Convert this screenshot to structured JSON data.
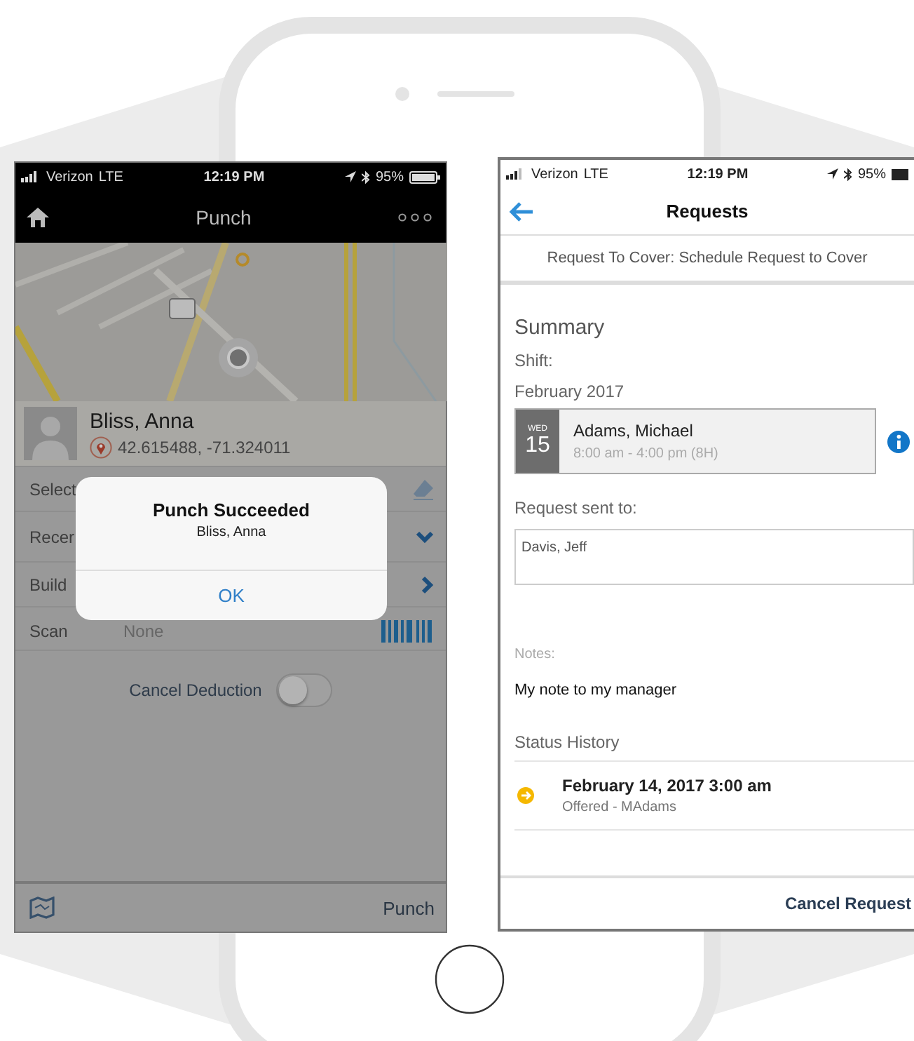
{
  "left_screen": {
    "status_bar": {
      "carrier": "Verizon",
      "network": "LTE",
      "time": "12:19 PM",
      "battery": "95%"
    },
    "nav_bar": {
      "title": "Punch"
    },
    "employee": {
      "name": "Bliss, Anna",
      "coordinates": "42.615488, -71.324011"
    },
    "rows": [
      {
        "kind": "edit",
        "label": "Select"
      },
      {
        "kind": "dropdown",
        "label": "Recer"
      },
      {
        "kind": "link",
        "label": "Build"
      },
      {
        "kind": "scan",
        "label": "Scan",
        "value": "None"
      }
    ],
    "cancel_deduction": {
      "label": "Cancel Deduction",
      "on": false
    },
    "footer": {
      "action": "Punch"
    },
    "dialog": {
      "title": "Punch Succeeded",
      "message": "Bliss, Anna",
      "button": "OK"
    }
  },
  "right_screen": {
    "status_bar": {
      "carrier": "Verizon",
      "network": "LTE",
      "time": "12:19 PM",
      "battery": "95%"
    },
    "nav_bar": {
      "title": "Requests"
    },
    "subtitle": "Request To Cover: Schedule Request to Cover",
    "summary_heading": "Summary",
    "shift_label": "Shift:",
    "month": "February 2017",
    "shift": {
      "weekday": "WED",
      "day": "15",
      "name": "Adams, Michael",
      "hours": "8:00 am - 4:00 pm (8H)"
    },
    "sent_to_label": "Request sent to:",
    "sent_to": "Davis, Jeff",
    "notes_label": "Notes:",
    "notes": "My note to my manager",
    "history_heading": "Status History",
    "history": [
      {
        "date": "February 14, 2017 3:00 am",
        "status": "Offered - MAdams"
      }
    ],
    "footer": {
      "action": "Cancel Request"
    }
  }
}
